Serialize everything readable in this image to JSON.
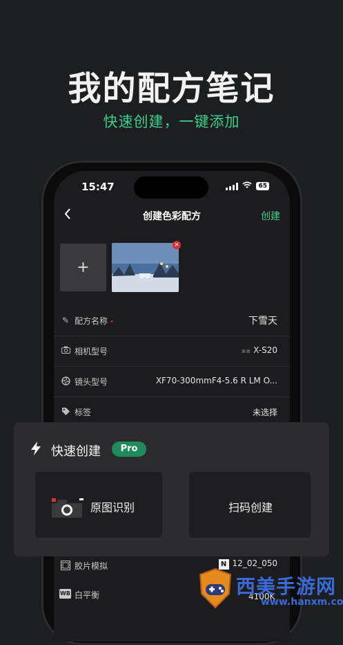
{
  "promo": {
    "headline": "我的配方笔记",
    "tagline": "快速创建，一键添加"
  },
  "status_bar": {
    "time": "15:47",
    "battery": "65"
  },
  "nav": {
    "back_icon": "chevron-left-icon",
    "title": "创建色彩配方",
    "create_label": "创建"
  },
  "images": {
    "add_label": "+",
    "remove_label": "×"
  },
  "form": {
    "recipe_name": {
      "label": "配方名称",
      "required_mark": "•",
      "value": "下雪天"
    },
    "camera_model": {
      "label": "相机型号",
      "value": "X-S20"
    },
    "lens_model": {
      "label": "镜头型号",
      "value": "XF70-300mmF4-5.6 R LM O..."
    },
    "tags": {
      "label": "标签",
      "value": "未选择"
    },
    "film_sim": {
      "label": "胶片模拟",
      "value": "12_02_050"
    },
    "white_balance": {
      "label": "白平衡",
      "value": "4100K"
    }
  },
  "quick_create": {
    "title": "快速创建",
    "badge": "Pro",
    "option_image": "原图识别",
    "option_scan": "扫码创建"
  },
  "watermark": {
    "name": "西美手游网",
    "url": "www.hanxm.com"
  },
  "colors": {
    "accent": "#3ccf8e",
    "background": "#1d1e20",
    "sheet": "#2c2c2e",
    "pro_badge": "#1f8a5a",
    "required": "#e0303a"
  }
}
